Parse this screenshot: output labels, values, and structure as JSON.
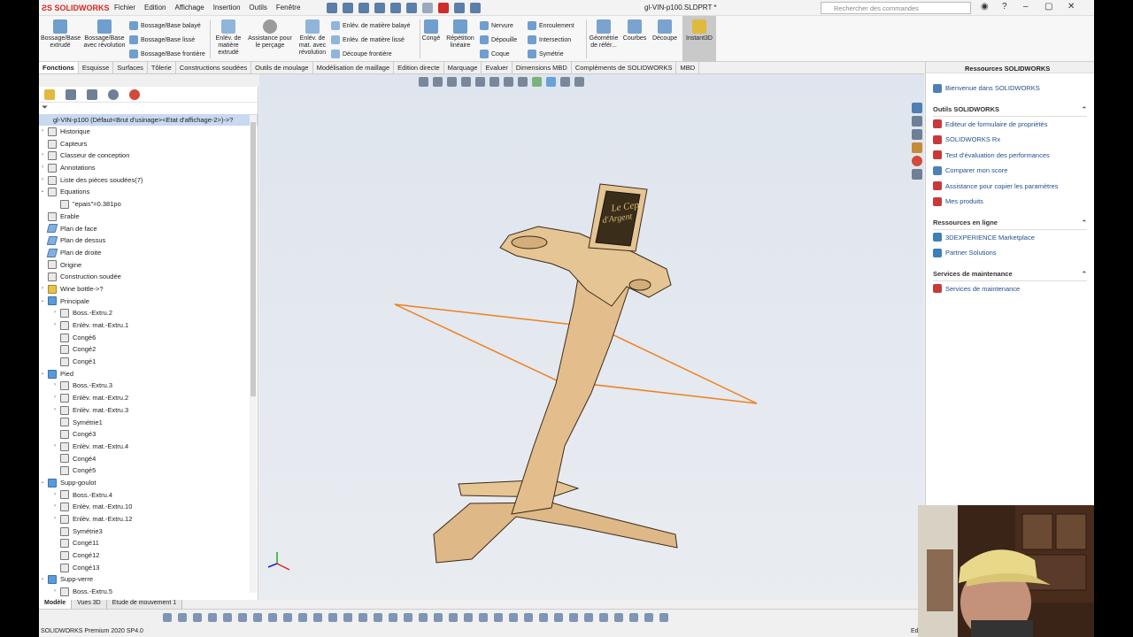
{
  "app": {
    "brand": "SOLIDWORKS",
    "document_title": "gl-VIN-p100.SLDPRT *",
    "menu": [
      "Fichier",
      "Edition",
      "Affichage",
      "Insertion",
      "Outils",
      "Fenêtre"
    ],
    "search_placeholder": "Rechercher des commandes"
  },
  "ribbon": {
    "bossage_extrude": "Bossage/Base extrudé",
    "bossage_revolution": "Bossage/Base avec révolution",
    "bossage_balaye": "Bossage/Base balayé",
    "bossage_lisse": "Bossage/Base lissé",
    "bossage_frontiere": "Bossage/Base frontière",
    "enlev_extrude": "Enlév. de matière extrudé",
    "assistance_percage": "Assistance pour le perçage",
    "enlev_revolution": "Enlév. de mat. avec révolution",
    "enlev_balaye": "Enlév. de matière balayé",
    "enlev_lisse": "Enlév. de matière lissé",
    "decoupe_frontiere": "Découpe frontière",
    "conge": "Congé",
    "repetition": "Répétition linéaire",
    "nervure": "Nervure",
    "depouille": "Dépouille",
    "coque": "Coque",
    "enroulement": "Enroulement",
    "intersection": "Intersection",
    "symetrie": "Symétrie",
    "geometrie": "Géométrie de référ...",
    "courbes": "Courbes",
    "decoupe": "Découpe",
    "instant3d": "Instant3D"
  },
  "tabs": [
    "Fonctions",
    "Esquisse",
    "Surfaces",
    "Tôlerie",
    "Constructions soudées",
    "Outils de moulage",
    "Modélisation de maillage",
    "Edition directe",
    "Marquage",
    "Evaluer",
    "Dimensions MBD",
    "Compléments de SOLIDWORKS",
    "MBD"
  ],
  "tree": {
    "root": "gl-VIN-p100  (Défaut<Brut d'usinage><Etat d'affichage-2>)->?",
    "nodes": [
      {
        "label": "Historique",
        "level": 0,
        "exp": "›",
        "kind": "feat"
      },
      {
        "label": "Capteurs",
        "level": 0,
        "exp": "",
        "kind": "feat"
      },
      {
        "label": "Classeur de conception",
        "level": 0,
        "exp": "›",
        "kind": "feat"
      },
      {
        "label": "Annotations",
        "level": 0,
        "exp": "›",
        "kind": "feat"
      },
      {
        "label": "Liste des pièces soudées(7)",
        "level": 0,
        "exp": "›",
        "kind": "feat"
      },
      {
        "label": "Equations",
        "level": 0,
        "exp": "⌄",
        "kind": "feat"
      },
      {
        "label": "\"epais\"=0.381po",
        "level": 1,
        "exp": "",
        "kind": "feat"
      },
      {
        "label": "Erable",
        "level": 0,
        "exp": "",
        "kind": "feat"
      },
      {
        "label": "Plan de face",
        "level": 0,
        "exp": "",
        "kind": "plane"
      },
      {
        "label": "Plan de dessus",
        "level": 0,
        "exp": "",
        "kind": "plane"
      },
      {
        "label": "Plan de droite",
        "level": 0,
        "exp": "",
        "kind": "plane"
      },
      {
        "label": "Origine",
        "level": 0,
        "exp": "",
        "kind": "feat"
      },
      {
        "label": "Construction soudée",
        "level": 0,
        "exp": "",
        "kind": "feat"
      },
      {
        "label": "Wine bottle->?",
        "level": 0,
        "exp": "›",
        "kind": "wine"
      },
      {
        "label": "Principale",
        "level": 0,
        "exp": "⌄",
        "kind": "folder"
      },
      {
        "label": "Boss.-Extru.2",
        "level": 1,
        "exp": "›",
        "kind": "feat"
      },
      {
        "label": "Enlèv. mat.-Extru.1",
        "level": 1,
        "exp": "›",
        "kind": "feat"
      },
      {
        "label": "Congé6",
        "level": 1,
        "exp": "",
        "kind": "feat"
      },
      {
        "label": "Congé2",
        "level": 1,
        "exp": "",
        "kind": "feat"
      },
      {
        "label": "Congé1",
        "level": 1,
        "exp": "",
        "kind": "feat"
      },
      {
        "label": "Pied",
        "level": 0,
        "exp": "⌄",
        "kind": "folder"
      },
      {
        "label": "Boss.-Extru.3",
        "level": 1,
        "exp": "›",
        "kind": "feat"
      },
      {
        "label": "Enlèv. mat.-Extru.2",
        "level": 1,
        "exp": "›",
        "kind": "feat"
      },
      {
        "label": "Enlèv. mat.-Extru.3",
        "level": 1,
        "exp": "›",
        "kind": "feat"
      },
      {
        "label": "Symétrie1",
        "level": 1,
        "exp": "",
        "kind": "feat"
      },
      {
        "label": "Congé3",
        "level": 1,
        "exp": "",
        "kind": "feat"
      },
      {
        "label": "Enlèv. mat.-Extru.4",
        "level": 1,
        "exp": "›",
        "kind": "feat"
      },
      {
        "label": "Congé4",
        "level": 1,
        "exp": "",
        "kind": "feat"
      },
      {
        "label": "Congé5",
        "level": 1,
        "exp": "",
        "kind": "feat"
      },
      {
        "label": "Supp-goulot",
        "level": 0,
        "exp": "⌄",
        "kind": "folder"
      },
      {
        "label": "Boss.-Extru.4",
        "level": 1,
        "exp": "›",
        "kind": "feat"
      },
      {
        "label": "Enlèv. mat.-Extru.10",
        "level": 1,
        "exp": "›",
        "kind": "feat"
      },
      {
        "label": "Enlèv. mat.-Extru.12",
        "level": 1,
        "exp": "›",
        "kind": "feat"
      },
      {
        "label": "Symétrie3",
        "level": 1,
        "exp": "",
        "kind": "feat"
      },
      {
        "label": "Congé11",
        "level": 1,
        "exp": "",
        "kind": "feat"
      },
      {
        "label": "Congé12",
        "level": 1,
        "exp": "",
        "kind": "feat"
      },
      {
        "label": "Congé13",
        "level": 1,
        "exp": "",
        "kind": "feat"
      },
      {
        "label": "Supp-verre",
        "level": 0,
        "exp": "⌄",
        "kind": "folder"
      },
      {
        "label": "Boss.-Extru.5",
        "level": 1,
        "exp": "›",
        "kind": "feat"
      }
    ]
  },
  "bottom_tabs": [
    "Modèle",
    "Vues 3D",
    "Etude de mouvement 1"
  ],
  "model": {
    "plate_text_1": "Le Cep",
    "plate_text_2": "d'Argent"
  },
  "resources": {
    "title": "Ressources SOLIDWORKS",
    "welcome": "Bienvenue dans SOLIDWORKS",
    "sections": [
      {
        "title": "Outils SOLIDWORKS",
        "items": [
          "Editeur de formulaire de propriétés",
          "SOLIDWORKS Rx",
          "Test d'évaluation des performances",
          "Comparer mon score",
          "Assistance pour copier les paramètres",
          "Mes produits"
        ]
      },
      {
        "title": "Ressources en ligne",
        "items": [
          "3DEXPERIENCE Marketplace",
          "Partner Solutions"
        ]
      },
      {
        "title": "Services de maintenance",
        "items": [
          "Services de maintenance"
        ]
      }
    ]
  },
  "status": {
    "left": "SOLIDWORKS Premium 2020 SP4.0",
    "right": "Ed"
  }
}
